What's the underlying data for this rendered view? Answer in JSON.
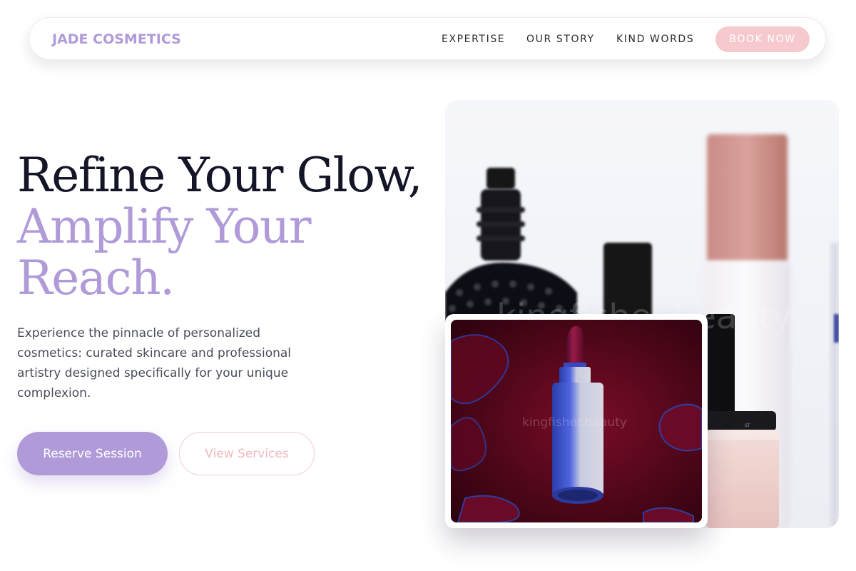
{
  "nav": {
    "brand": "JADE COSMETICS",
    "links": [
      "EXPERTISE",
      "OUR STORY",
      "KIND WORDS"
    ],
    "cta": "BOOK NOW"
  },
  "hero": {
    "headline_line1": "Refine Your Glow,",
    "headline_line2": "Amplify Your",
    "headline_line3": "Reach.",
    "description": "Experience the pinnacle of personalized cosmetics: curated skincare and professional artistry designed specifically for your unique complexion.",
    "primary_button": "Reserve Session",
    "secondary_button": "View Services"
  },
  "images": {
    "main_watermark": "kingfisher.beauty",
    "inset_watermark": "kingfisher.beauty"
  },
  "colors": {
    "accent": "#b09bd8",
    "pink": "#f6c9cd",
    "dark_text": "#141628"
  }
}
